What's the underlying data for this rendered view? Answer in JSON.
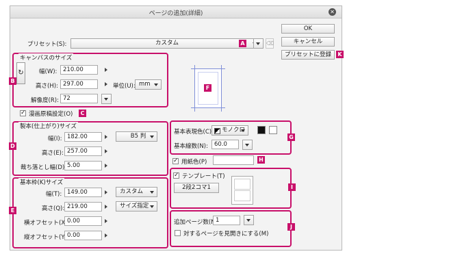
{
  "title": "ページの追加(詳細)",
  "buttons": {
    "ok": "OK",
    "cancel": "キャンセル",
    "register": "プリセットに登録"
  },
  "preset": {
    "label": "プリセット(S):",
    "value": "カスタム"
  },
  "canvas": {
    "group": "キャンバスのサイズ",
    "width_label": "幅(W):",
    "width": "210.00",
    "height_label": "高さ(H):",
    "height": "297.00",
    "unit_label": "単位(U):",
    "unit": "mm",
    "res_label": "解像度(R):",
    "res": "72"
  },
  "manga": {
    "label": "漫画原稿設定(O)",
    "checked": true
  },
  "finish": {
    "group": "製本(仕上がり)サイズ",
    "width_label": "幅(I):",
    "width": "182.00",
    "height_label": "高さ(E):",
    "height": "257.00",
    "bleed_label": "裁ち落とし幅(D):",
    "bleed": "5.00",
    "size": "B5 判"
  },
  "frame": {
    "group": "基本枠(K)サイズ",
    "width_label": "幅(T):",
    "width": "149.00",
    "height_label": "高さ(Q):",
    "height": "219.00",
    "xoff_label": "横オフセット(X):",
    "xoff": "0.00",
    "yoff_label": "縦オフセット(Y):",
    "yoff": "0.00",
    "preset": "カスタム",
    "mode": "サイズ指定"
  },
  "color": {
    "label": "基本表現色(C):",
    "value": "モノクロ",
    "lines_label": "基本線数(N):",
    "lines": "60.0"
  },
  "paper": {
    "label": "用紙色(P)",
    "checked": true
  },
  "template": {
    "label": "テンプレート(T)",
    "checked": true,
    "button": "2段2コマ1"
  },
  "pages": {
    "label": "追加ページ数(N):",
    "value": "1",
    "spread_label": "対するページを見開きにする(M)",
    "spread_checked": false
  },
  "badges": {
    "a": "A",
    "b": "B",
    "c": "C",
    "d": "D",
    "e": "E",
    "f": "F",
    "g": "G",
    "h": "H",
    "i": "I",
    "j": "J",
    "k": "K"
  },
  "colors": {
    "accent": "#c8106a"
  }
}
